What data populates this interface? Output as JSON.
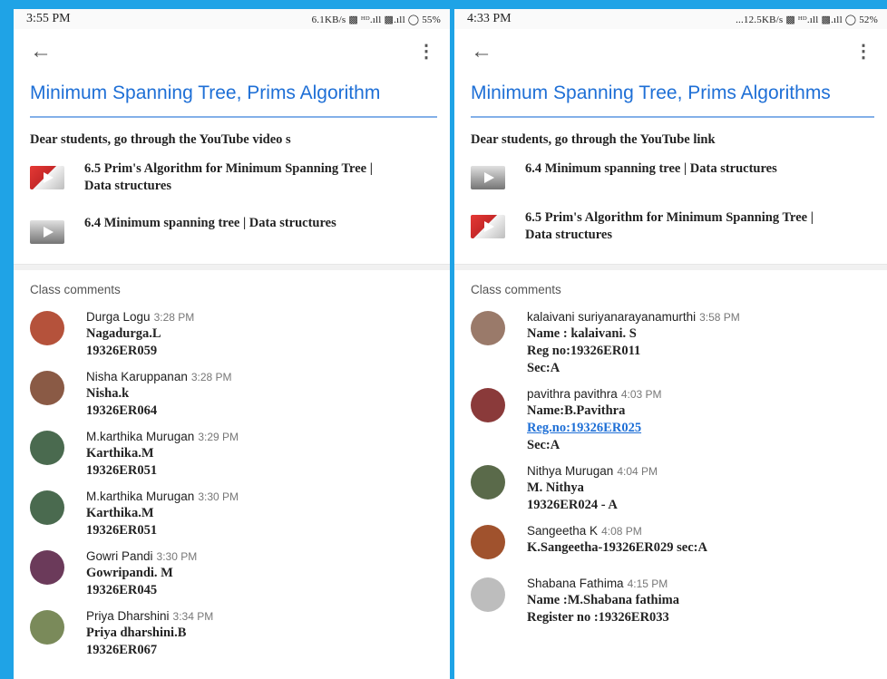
{
  "left": {
    "status": {
      "time": "3:55 PM",
      "indicators": "6.1KB/s ▩ ᴴᴰ.ıll ▩.ıll ◯ 55%"
    },
    "title": "Minimum Spanning Tree, Prims Algorithm",
    "description": "Dear students, go through the YouTube video s",
    "attachments": [
      {
        "label": "6.5 Prim's Algorithm for Minimum Spanning Tree | Data structures",
        "thumb": "red"
      },
      {
        "label": "6.4 Minimum spanning tree | Data structures",
        "thumb": "grey"
      }
    ],
    "comments_header": "Class comments",
    "comments": [
      {
        "name": "Durga Logu",
        "time": "3:28 PM",
        "lines": [
          "Nagadurga.L",
          "19326ER059"
        ],
        "avatar_color": "#b5523b"
      },
      {
        "name": "Nisha Karuppanan",
        "time": "3:28 PM",
        "lines": [
          "Nisha.k",
          "19326ER064"
        ],
        "avatar_color": "#8a5a45"
      },
      {
        "name": "M.karthika Murugan",
        "time": "3:29 PM",
        "lines": [
          "Karthika.M",
          "19326ER051"
        ],
        "avatar_color": "#4a6a4f"
      },
      {
        "name": "M.karthika Murugan",
        "time": "3:30 PM",
        "lines": [
          "Karthika.M",
          "19326ER051"
        ],
        "avatar_color": "#4a6a4f"
      },
      {
        "name": "Gowri Pandi",
        "time": "3:30 PM",
        "lines": [
          "Gowripandi. M",
          "19326ER045"
        ],
        "avatar_color": "#6b3a5a"
      },
      {
        "name": "Priya Dharshini",
        "time": "3:34 PM",
        "lines": [
          "Priya dharshini.B",
          "19326ER067"
        ],
        "avatar_color": "#7a8a5a"
      }
    ]
  },
  "right": {
    "status": {
      "time": "4:33 PM",
      "indicators": "...12.5KB/s ▩ ᴴᴰ.ıll ▩.ıll ◯ 52%"
    },
    "title": "Minimum Spanning Tree, Prims Algorithms",
    "description": "Dear students, go through the YouTube link",
    "attachments": [
      {
        "label": "6.4 Minimum spanning tree | Data structures",
        "thumb": "grey"
      },
      {
        "label": "6.5 Prim's Algorithm for Minimum Spanning Tree | Data structures",
        "thumb": "red"
      }
    ],
    "comments_header": "Class comments",
    "comments": [
      {
        "name": "kalaivani suriyanarayanamurthi",
        "time": "3:58 PM",
        "lines": [
          "Name : kalaivani. S",
          "Reg no:19326ER011",
          "Sec:A"
        ],
        "avatar_color": "#9a7a6a"
      },
      {
        "name": "pavithra pavithra",
        "time": "4:03 PM",
        "lines": [
          "Name:B.Pavithra",
          "Reg.no:19326ER025",
          "Sec:A"
        ],
        "avatar_color": "#8a3a3a"
      },
      {
        "name": "Nithya Murugan",
        "time": "4:04 PM",
        "lines": [
          "M. Nithya",
          "19326ER024 - A"
        ],
        "avatar_color": "#5a6a4a"
      },
      {
        "name": "Sangeetha K",
        "time": "4:08 PM",
        "lines": [
          "K.Sangeetha-19326ER029 sec:A"
        ],
        "avatar_color": "#a0522d"
      },
      {
        "name": "Shabana Fathima",
        "time": "4:15 PM",
        "lines": [
          "Name :M.Shabana fathima",
          "Register no :19326ER033"
        ],
        "avatar_color": "#bdbdbd"
      }
    ]
  }
}
